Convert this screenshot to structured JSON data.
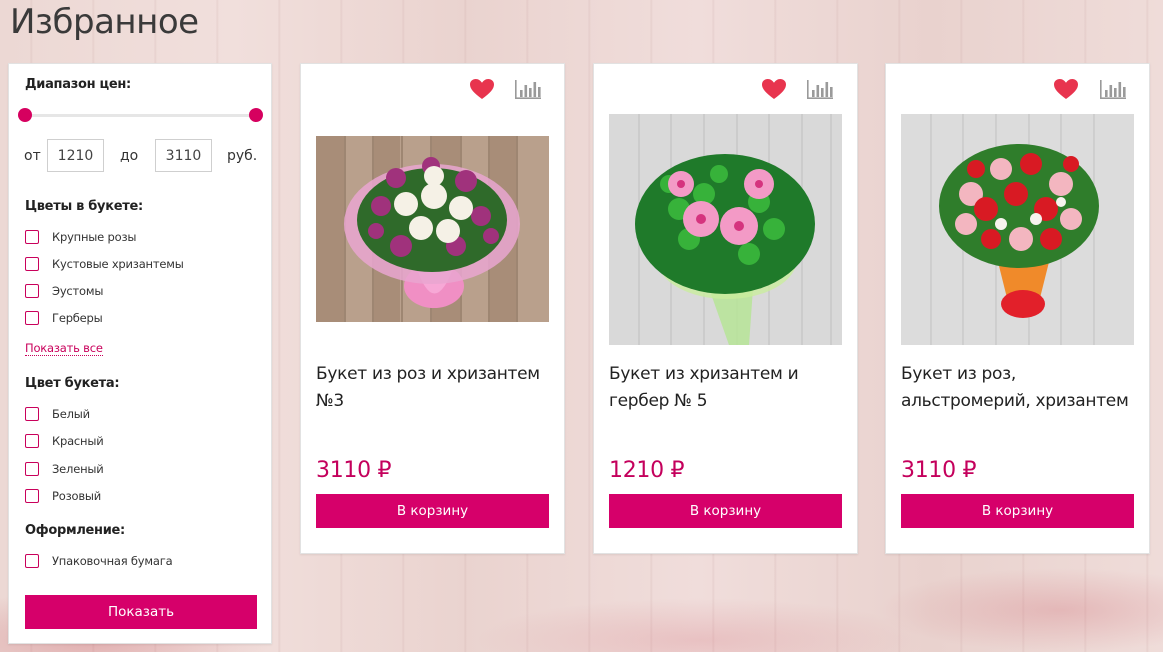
{
  "page": {
    "title": "Избранное"
  },
  "colors": {
    "accent": "#d6006a",
    "price": "#c4005c"
  },
  "filters": {
    "price_range": {
      "title": "Диапазон цен:",
      "from_label": "от",
      "to_label": "до",
      "currency_label": "руб.",
      "min_value": "1210",
      "max_value": "3110"
    },
    "flowers": {
      "title": "Цветы в букете:",
      "options": [
        "Крупные розы",
        "Кустовые хризантемы",
        "Эустомы",
        "Герберы"
      ],
      "show_all": "Показать все"
    },
    "color": {
      "title": "Цвет букета:",
      "options": [
        "Белый",
        "Красный",
        "Зеленый",
        "Розовый"
      ]
    },
    "decoration": {
      "title": "Оформление:",
      "options": [
        "Упаковочная бумага"
      ]
    },
    "submit_label": "Показать"
  },
  "products": [
    {
      "title": "Букет из роз и хризантем №3",
      "price": "3110 ₽",
      "cart_label": "В корзину",
      "icons": [
        "heart-icon",
        "compare-icon"
      ]
    },
    {
      "title": "Букет из хризантем и гербер № 5",
      "price": "1210 ₽",
      "cart_label": "В корзину",
      "icons": [
        "heart-icon",
        "compare-icon"
      ]
    },
    {
      "title": "Букет из роз, альстромерий, хризантем",
      "price": "3110 ₽",
      "cart_label": "В корзину",
      "icons": [
        "heart-icon",
        "compare-icon"
      ]
    }
  ]
}
